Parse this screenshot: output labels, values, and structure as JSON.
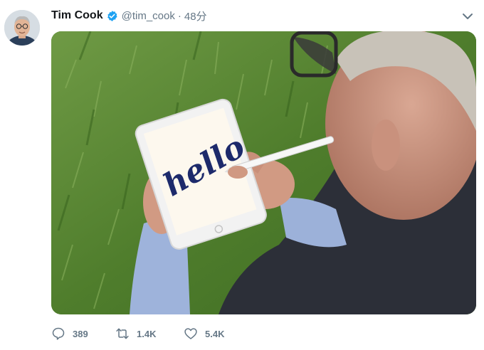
{
  "author": {
    "name": "Tim Cook",
    "handle": "@tim_cook",
    "separator": "·",
    "time": "48分"
  },
  "media": {
    "handwriting": "hello"
  },
  "actions": {
    "replies": "389",
    "retweets": "1.4K",
    "likes": "5.4K"
  },
  "colors": {
    "verified": "#1da1f2",
    "secondary_text": "#657786"
  },
  "icons": [
    "verified-badge-icon",
    "chevron-down-icon",
    "reply-icon",
    "retweet-icon",
    "like-icon"
  ]
}
